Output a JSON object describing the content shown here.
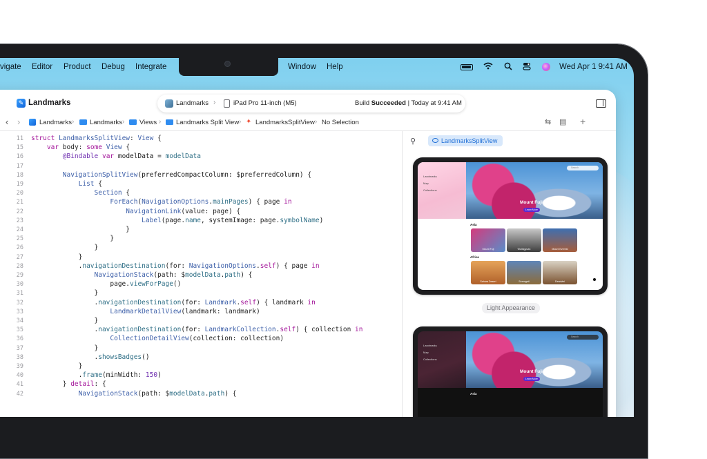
{
  "menubar": {
    "left_items": [
      "vigate",
      "Editor",
      "Product",
      "Debug",
      "Integrate"
    ],
    "right_items": [
      "Window",
      "Help"
    ],
    "datetime": "Wed Apr 1  9:41 AM",
    "icons": [
      "battery-icon",
      "wifi-icon",
      "search-icon",
      "control-center-icon",
      "siri-icon"
    ]
  },
  "toolbar": {
    "project_name": "Landmarks",
    "scheme": "Landmarks",
    "device": "iPad Pro 11-inch (M5)",
    "status_prefix": "Build",
    "status_bold": "Succeeded",
    "status_suffix": " | Today at 9:41 AM"
  },
  "jumpbar": {
    "crumbs": [
      "Landmarks",
      "Landmarks",
      "Views",
      "Landmarks Split View",
      "LandmarksSplitView",
      "No Selection"
    ]
  },
  "editor": {
    "lines": [
      {
        "n": "11",
        "html": "<span class=\"kw\">struct</span> <span class=\"ty\">LandmarksSplitView</span>: <span class=\"ty\">View</span> {"
      },
      {
        "n": "15",
        "html": "    <span class=\"kw\">var</span> body: <span class=\"kw\">some</span> <span class=\"ty\">View</span> {"
      },
      {
        "n": "16",
        "html": "        <span class=\"pr\">@Bindable</span> <span class=\"kw\">var</span> modelData = <span class=\"fn\">modelData</span>"
      },
      {
        "n": "17",
        "html": ""
      },
      {
        "n": "18",
        "html": "        <span class=\"ty\">NavigationSplitView</span>(preferredCompactColumn: $preferredColumn) {"
      },
      {
        "n": "19",
        "html": "            <span class=\"ty\">List</span> {"
      },
      {
        "n": "20",
        "html": "                <span class=\"ty\">Section</span> {"
      },
      {
        "n": "21",
        "html": "                    <span class=\"ty\">ForEach</span>(<span class=\"ty\">NavigationOptions</span>.<span class=\"fn\">mainPages</span>) { page <span class=\"kw\">in</span>"
      },
      {
        "n": "22",
        "html": "                        <span class=\"ty\">NavigationLink</span>(value: page) {"
      },
      {
        "n": "23",
        "html": "                            <span class=\"ty\">Label</span>(page.<span class=\"fn\">name</span>, systemImage: page.<span class=\"fn\">symbolName</span>)"
      },
      {
        "n": "24",
        "html": "                        }"
      },
      {
        "n": "25",
        "html": "                    }"
      },
      {
        "n": "26",
        "html": "                }"
      },
      {
        "n": "27",
        "html": "            }"
      },
      {
        "n": "28",
        "html": "            .<span class=\"fn\">navigationDestination</span>(for: <span class=\"ty\">NavigationOptions</span>.<span class=\"kw\">self</span>) { page <span class=\"kw\">in</span>"
      },
      {
        "n": "29",
        "html": "                <span class=\"ty\">NavigationStack</span>(path: $<span class=\"fn\">modelData</span>.<span class=\"fn\">path</span>) {"
      },
      {
        "n": "30",
        "html": "                    page.<span class=\"fn\">viewForPage</span>()"
      },
      {
        "n": "31",
        "html": "                }"
      },
      {
        "n": "32",
        "html": "                .<span class=\"fn\">navigationDestination</span>(for: <span class=\"ty\">Landmark</span>.<span class=\"kw\">self</span>) { landmark <span class=\"kw\">in</span>"
      },
      {
        "n": "33",
        "html": "                    <span class=\"ty\">LandmarkDetailView</span>(landmark: landmark)"
      },
      {
        "n": "34",
        "html": "                }"
      },
      {
        "n": "35",
        "html": "                .<span class=\"fn\">navigationDestination</span>(for: <span class=\"ty\">LandmarkCollection</span>.<span class=\"kw\">self</span>) { collection <span class=\"kw\">in</span>"
      },
      {
        "n": "36",
        "html": "                    <span class=\"ty\">CollectionDetailView</span>(collection: collection)"
      },
      {
        "n": "37",
        "html": "                }"
      },
      {
        "n": "38",
        "html": "                .<span class=\"fn\">showsBadges</span>()"
      },
      {
        "n": "39",
        "html": "            }"
      },
      {
        "n": "40",
        "html": "            .<span class=\"fn\">frame</span>(minWidth: <span class=\"pr\">150</span>)"
      },
      {
        "n": "41",
        "html": "        } <span class=\"kw\">detail</span>: {"
      },
      {
        "n": "42",
        "html": "            <span class=\"ty\">NavigationStack</span>(path: $<span class=\"fn\">modelData</span>.<span class=\"fn\">path</span>) {"
      }
    ]
  },
  "canvas": {
    "preview_name": "LandmarksSplitView",
    "appearance_label": "Light Appearance",
    "ipad": {
      "sidebar": [
        "Landmarks",
        "Map",
        "Collections"
      ],
      "search": "Search",
      "hero_title": "Mount Fuji",
      "hero_button": "Learn More",
      "sections": [
        {
          "title": "Asia",
          "items": [
            "Mount Fuji",
            "Wulingyuan",
            "Mount Everest"
          ]
        },
        {
          "title": "Africa",
          "items": [
            "Sahara Desert",
            "Serengeti",
            "Deadvlei"
          ]
        }
      ]
    }
  },
  "colors": {
    "accent": "#1f6fd6",
    "keyword": "#a3169a",
    "type": "#3b5ea8",
    "bezel": "#1b1c1f"
  }
}
